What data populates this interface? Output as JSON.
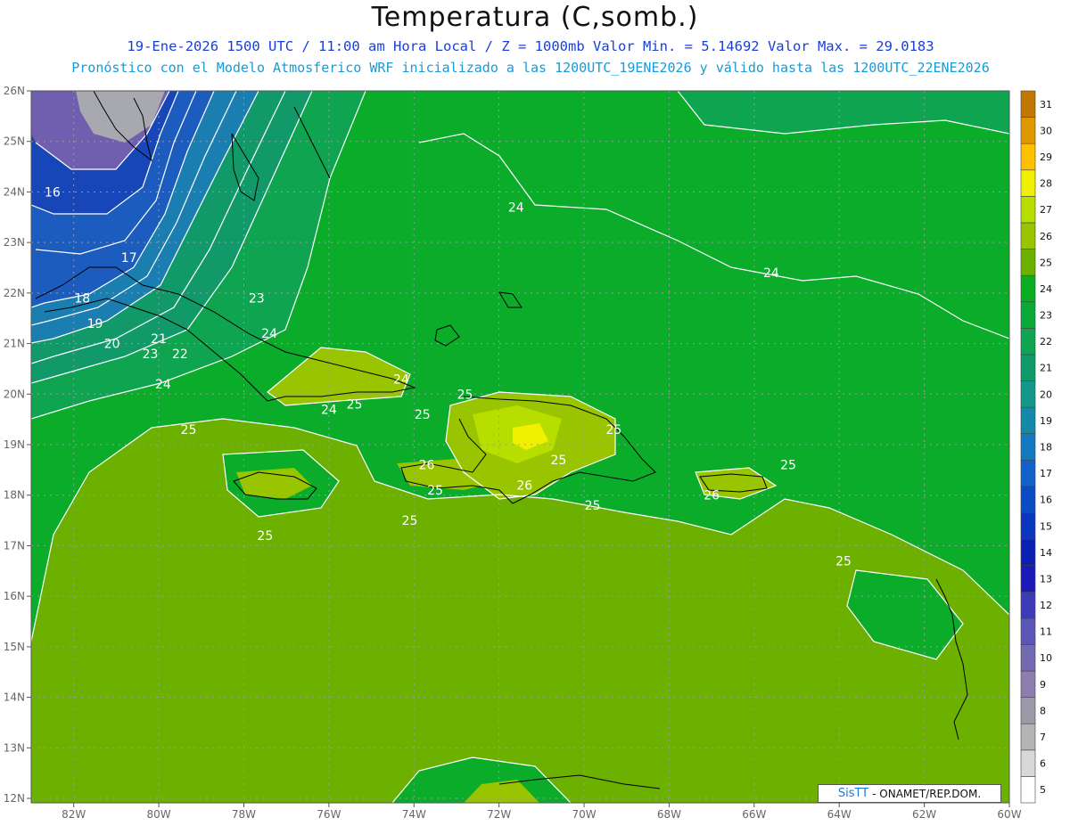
{
  "title": "Temperatura (C,somb.)",
  "subtitle_line1": "19-Ene-2026 1500 UTC / 11:00 am Hora Local / Z = 1000mb  Valor Min. = 5.14692  Valor Max. = 29.0183",
  "subtitle_line2": "Pronóstico con el Modelo Atmosferico WRF inicializado a las 1200UTC_19ENE2026 y válido hasta las  1200UTC_22ENE2026",
  "credit": {
    "brand": "SisTT",
    "text": "- ONAMET/REP.DOM."
  },
  "lat_labels": [
    "26N",
    "25N",
    "24N",
    "23N",
    "22N",
    "21N",
    "20N",
    "19N",
    "18N",
    "17N",
    "16N",
    "15N",
    "14N",
    "13N",
    "12N"
  ],
  "lon_labels": [
    "82W",
    "80W",
    "78W",
    "76W",
    "74W",
    "72W",
    "70W",
    "68W",
    "66W",
    "64W",
    "62W",
    "60W"
  ],
  "contour_labels": [
    {
      "text": "16",
      "lon": -82.5,
      "lat": 24.0
    },
    {
      "text": "17",
      "lon": -80.7,
      "lat": 22.7
    },
    {
      "text": "18",
      "lon": -81.8,
      "lat": 21.9
    },
    {
      "text": "19",
      "lon": -81.5,
      "lat": 21.4
    },
    {
      "text": "20",
      "lon": -81.1,
      "lat": 21.0
    },
    {
      "text": "21",
      "lon": -80.0,
      "lat": 21.1
    },
    {
      "text": "23",
      "lon": -80.2,
      "lat": 20.8
    },
    {
      "text": "22",
      "lon": -79.5,
      "lat": 20.8
    },
    {
      "text": "24",
      "lon": -79.9,
      "lat": 20.2
    },
    {
      "text": "23",
      "lon": -77.7,
      "lat": 21.9
    },
    {
      "text": "24",
      "lon": -77.4,
      "lat": 21.2
    },
    {
      "text": "24",
      "lon": -71.6,
      "lat": 23.7
    },
    {
      "text": "24",
      "lon": -65.6,
      "lat": 22.4
    },
    {
      "text": "24",
      "lon": -76.0,
      "lat": 19.7
    },
    {
      "text": "25",
      "lon": -75.4,
      "lat": 19.8
    },
    {
      "text": "24",
      "lon": -74.3,
      "lat": 20.3
    },
    {
      "text": "25",
      "lon": -72.8,
      "lat": 20.0
    },
    {
      "text": "25",
      "lon": -79.3,
      "lat": 19.3
    },
    {
      "text": "25",
      "lon": -73.8,
      "lat": 19.6
    },
    {
      "text": "26",
      "lon": -73.7,
      "lat": 18.6
    },
    {
      "text": "25",
      "lon": -73.5,
      "lat": 18.1
    },
    {
      "text": "25",
      "lon": -74.1,
      "lat": 17.5
    },
    {
      "text": "26",
      "lon": -71.4,
      "lat": 18.2
    },
    {
      "text": "25",
      "lon": -70.6,
      "lat": 18.7
    },
    {
      "text": "25",
      "lon": -69.3,
      "lat": 19.3
    },
    {
      "text": "25",
      "lon": -69.8,
      "lat": 17.8
    },
    {
      "text": "26",
      "lon": -67.0,
      "lat": 18.0
    },
    {
      "text": "25",
      "lon": -65.2,
      "lat": 18.6
    },
    {
      "text": "25",
      "lon": -63.9,
      "lat": 16.7
    },
    {
      "text": "25",
      "lon": -77.5,
      "lat": 17.2
    }
  ],
  "colorbar": {
    "levels": [
      "5",
      "6",
      "7",
      "8",
      "9",
      "10",
      "11",
      "12",
      "13",
      "14",
      "15",
      "16",
      "17",
      "18",
      "19",
      "20",
      "21",
      "22",
      "23",
      "24",
      "25",
      "26",
      "27",
      "28",
      "29",
      "30",
      "31"
    ],
    "colors": [
      "#ffffff",
      "#d8d8d8",
      "#b4b4b4",
      "#9a9aa8",
      "#8c7fb0",
      "#7269b0",
      "#5a56b6",
      "#3c3cba",
      "#1a1ab8",
      "#0a20b4",
      "#0a36c0",
      "#0a4cc6",
      "#1062c8",
      "#1478c0",
      "#148aa8",
      "#12988a",
      "#109a68",
      "#0ea450",
      "#0aa838",
      "#0aac20",
      "#6cb000",
      "#98c400",
      "#b8de00",
      "#f0f000",
      "#ffc000",
      "#e09800",
      "#c07800"
    ]
  },
  "legend_colors": {
    "t16": "#1646b8",
    "t18": "#1c5cbe",
    "t20": "#1a7fb0",
    "t22": "#12996a",
    "t23": "#0fa450",
    "t24": "#0aac2a",
    "t25": "#6cb000",
    "t26": "#98c400",
    "t27": "#b8de00",
    "t28": "#f0f000"
  }
}
